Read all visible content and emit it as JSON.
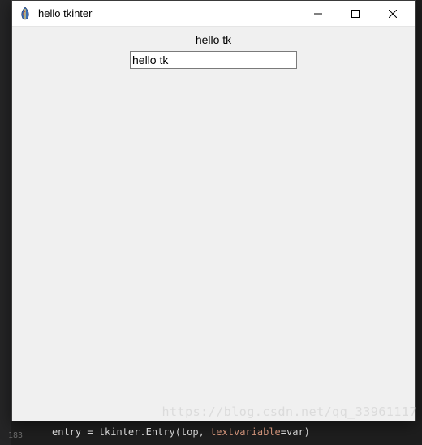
{
  "window": {
    "title": "hello tkinter",
    "icon_name": "tk-feather-icon"
  },
  "content": {
    "label_text": "hello tk",
    "entry_value": "hello tk"
  },
  "watermark": "https://blog.csdn.net/qq_33961117",
  "code_strip": {
    "line_number": "183",
    "plain": "entry = tkinter.Entry(top, ",
    "arg": "textvariable",
    "tail": "=var)"
  }
}
